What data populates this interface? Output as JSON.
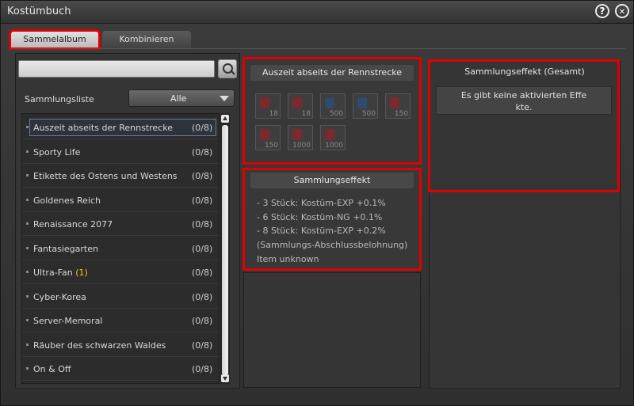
{
  "window": {
    "title": "Kostümbuch",
    "help_glyph": "?",
    "close_glyph": "✕"
  },
  "tabs": [
    {
      "label": "Sammelalbum"
    },
    {
      "label": "Kombinieren"
    }
  ],
  "search": {
    "placeholder": "",
    "icon": "search-icon"
  },
  "collection_list": {
    "label": "Sammlungsliste",
    "filter_value": "Alle",
    "items": [
      {
        "name": "Auszeit abseits der Rennstrecke",
        "badge": "",
        "count": "(0/8)"
      },
      {
        "name": "Sporty Life",
        "badge": "",
        "count": "(0/8)"
      },
      {
        "name": "Etikette des Ostens und Westens",
        "badge": "",
        "count": "(0/8)"
      },
      {
        "name": "Goldenes Reich",
        "badge": "",
        "count": "(0/8)"
      },
      {
        "name": "Renaissance 2077",
        "badge": "",
        "count": "(0/8)"
      },
      {
        "name": "Fantasiegarten",
        "badge": "",
        "count": "(0/8)"
      },
      {
        "name": "Ultra-Fan",
        "badge": "(1)",
        "count": "(0/8)"
      },
      {
        "name": "Cyber-Korea",
        "badge": "",
        "count": "(0/8)"
      },
      {
        "name": "Server-Memoral",
        "badge": "",
        "count": "(0/8)"
      },
      {
        "name": "Räuber des schwarzen Waldes",
        "badge": "",
        "count": "(0/8)"
      },
      {
        "name": "On & Off",
        "badge": "",
        "count": "(0/8)"
      }
    ]
  },
  "collection_detail": {
    "title": "Auszeit abseits der Rennstrecke",
    "slots": [
      {
        "num": "18",
        "color": "#7a2a2a"
      },
      {
        "num": "18",
        "color": "#7a2a2a"
      },
      {
        "num": "500",
        "color": "#2f4a6a"
      },
      {
        "num": "500",
        "color": "#2f4a6a"
      },
      {
        "num": "150",
        "color": "#7a2a2a"
      },
      {
        "num": "150",
        "color": "#7a2a2a"
      },
      {
        "num": "1000",
        "color": "#7a2a2a"
      },
      {
        "num": "1000",
        "color": "#7a2a2a"
      }
    ]
  },
  "collection_effect": {
    "title": "Sammlungseffekt",
    "lines": [
      "- 3 Stück: Kostüm-EXP +0.1%",
      "- 6 Stück: Kostüm-NG +0.1%",
      "- 8 Stück: Kostüm-EXP +0.2%",
      "(Sammlungs-Abschlussbelohnung)",
      "Item unknown"
    ]
  },
  "total_effect": {
    "title": "Sammlungseffekt (Gesamt)",
    "line1": "Es gibt keine aktivierten Effe",
    "line2": "kte."
  },
  "colors": {
    "highlight": "#e00000",
    "badge": "#f0d000"
  }
}
